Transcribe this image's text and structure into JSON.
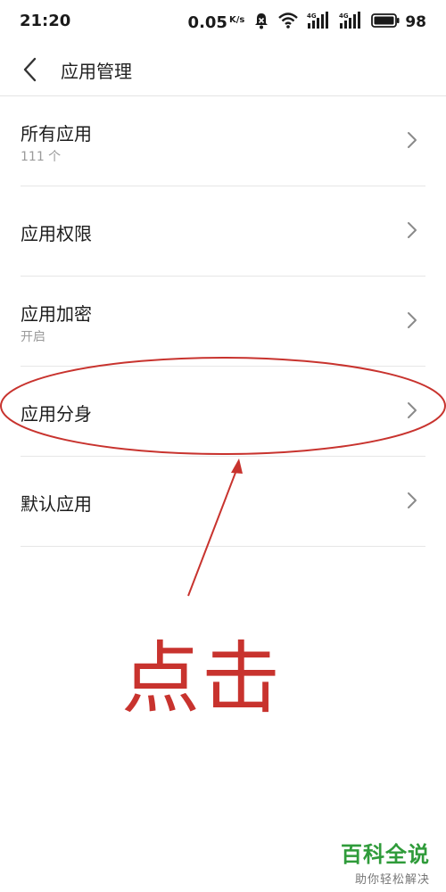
{
  "status_bar": {
    "time": "21:20",
    "speed": "0.05",
    "speed_unit": "K/s",
    "battery": "98"
  },
  "header": {
    "title": "应用管理"
  },
  "menu": {
    "items": [
      {
        "title": "所有应用",
        "subtitle": "111 个"
      },
      {
        "title": "应用权限",
        "subtitle": ""
      },
      {
        "title": "应用加密",
        "subtitle": "开启"
      },
      {
        "title": "应用分身",
        "subtitle": ""
      },
      {
        "title": "默认应用",
        "subtitle": ""
      }
    ]
  },
  "annotation": {
    "text": "点击",
    "color": "#c8332e"
  },
  "watermark": {
    "main": "百科全说",
    "sub": "助你轻松解决",
    "color": "#2f9b3a"
  }
}
